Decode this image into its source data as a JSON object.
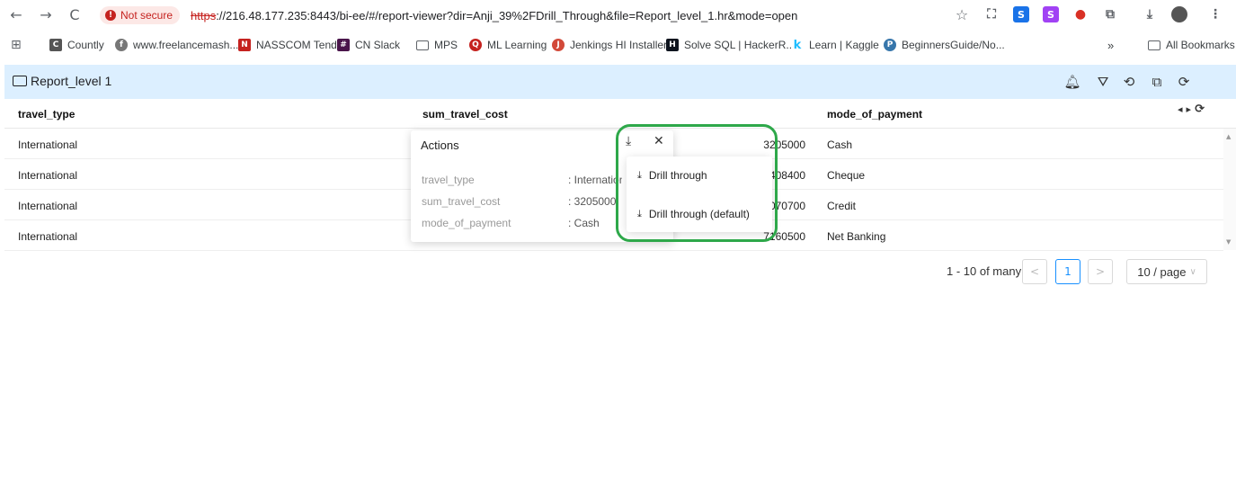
{
  "browser": {
    "back": "←",
    "forward": "→",
    "reload": "C",
    "security_label": "Not secure",
    "url_scheme": "https",
    "url_rest": "://216.48.177.235:8443/bi-ee/#/report-viewer?dir=Anji_39%2FDrill_Through&file=Report_level_1.hr&mode=open",
    "star": "☆"
  },
  "bookmarks": {
    "items": [
      "Countly",
      "www.freelancemash...",
      "NASSCOM Tender",
      "CN Slack",
      "MPS",
      "ML Learning",
      "Jenkings HI Installer",
      "Solve SQL | HackerR...",
      "Learn | Kaggle",
      "BeginnersGuide/No..."
    ],
    "more": "»",
    "all_bookmarks": "All Bookmarks"
  },
  "report": {
    "title": "Report_level 1"
  },
  "grid": {
    "columns": [
      "travel_type",
      "sum_travel_cost",
      "mode_of_payment"
    ],
    "rows": [
      {
        "travel_type": "International",
        "sum_travel_cost": "3205000",
        "mode_of_payment": "Cash"
      },
      {
        "travel_type": "International",
        "sum_travel_cost": "3408400",
        "mode_of_payment": "Cheque"
      },
      {
        "travel_type": "International",
        "sum_travel_cost": "3070700",
        "mode_of_payment": "Credit"
      },
      {
        "travel_type": "International",
        "sum_travel_cost": "7160500",
        "mode_of_payment": "Net Banking"
      }
    ]
  },
  "pager": {
    "summary": "1 - 10 of many",
    "prev": "<",
    "page": "1",
    "next": ">",
    "page_size": "10 / page"
  },
  "actions": {
    "title": "Actions",
    "fields": [
      {
        "label": "travel_type",
        "value": ": International"
      },
      {
        "label": "sum_travel_cost",
        "value": ": 3205000"
      },
      {
        "label": "mode_of_payment",
        "value": ": Cash"
      }
    ],
    "close": "✕",
    "download": "⤓",
    "menu": [
      "Drill through",
      "Drill through (default)"
    ]
  },
  "colors": {
    "header_bg": "#dcefff",
    "highlight": "#2ea84a",
    "pager_active": "#1890ff",
    "insecure": "#c5221f"
  }
}
